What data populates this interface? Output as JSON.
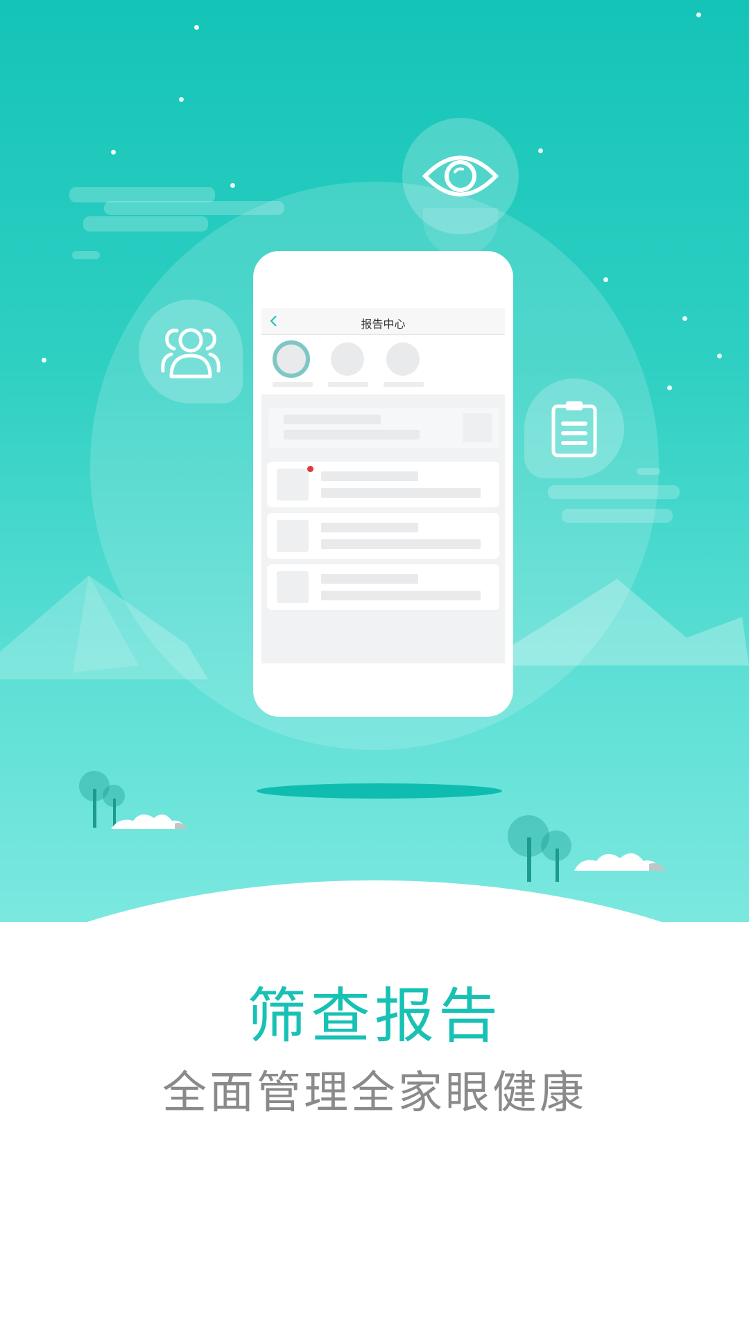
{
  "phone": {
    "app_title": "报告中心"
  },
  "headline": {
    "title": "筛查报告",
    "subtitle": "全面管理全家眼健康"
  },
  "colors": {
    "accent": "#17c1b4",
    "subtitle": "#8a8a8a",
    "badge": "#e0383e"
  }
}
